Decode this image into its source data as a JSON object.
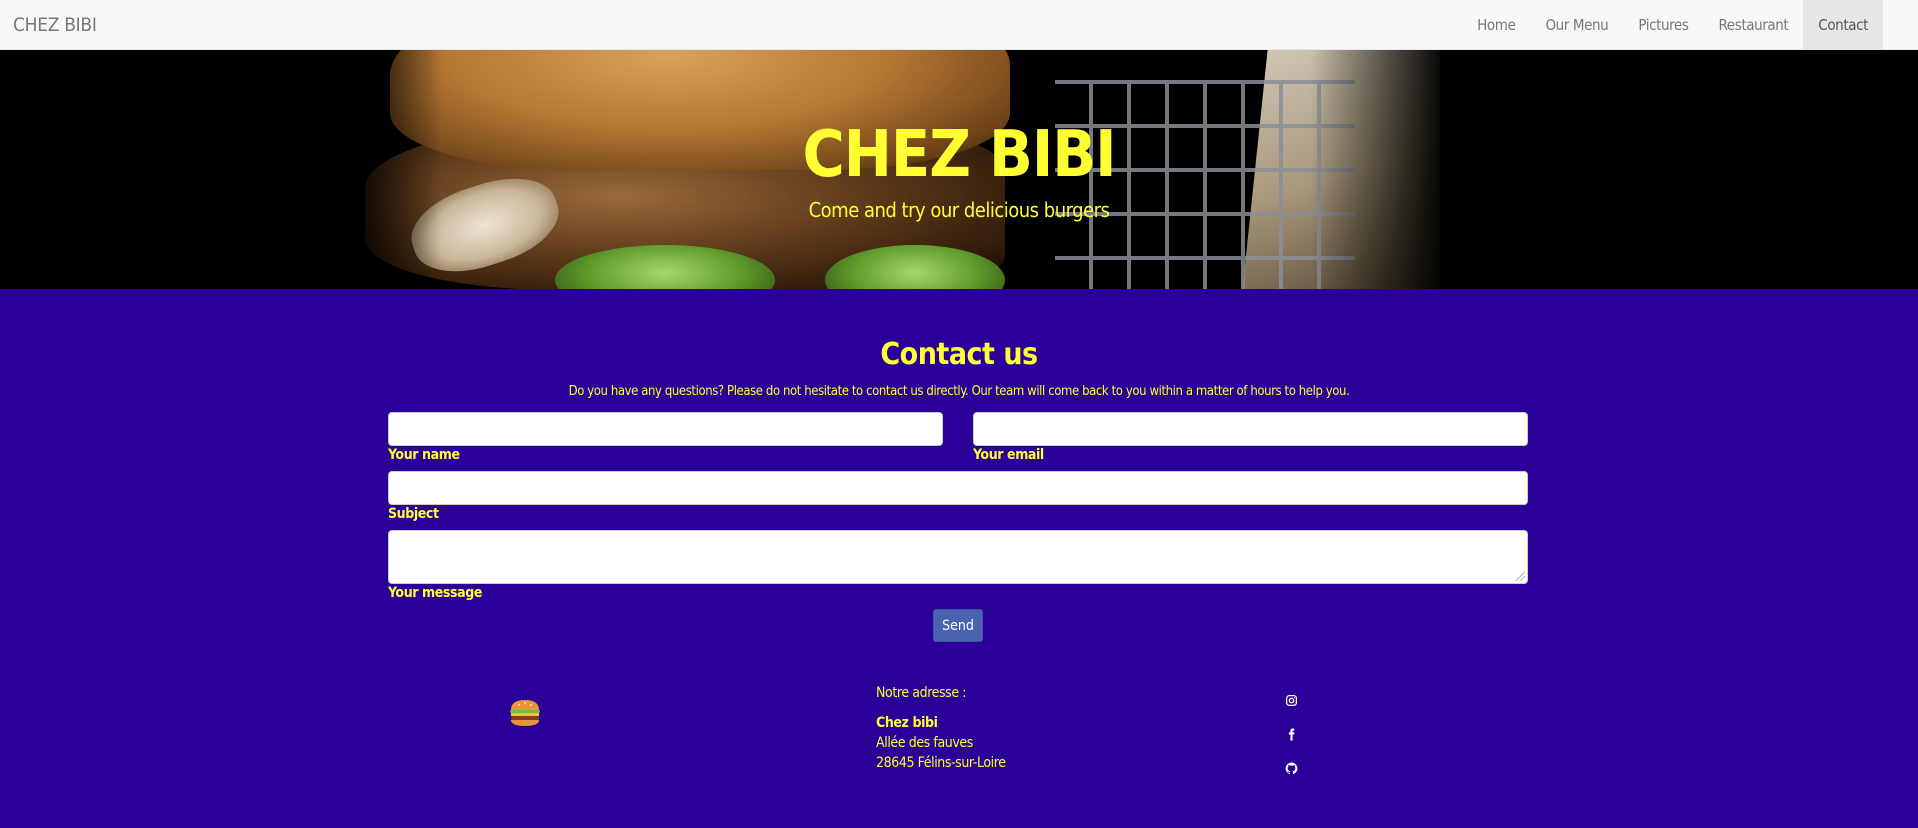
{
  "navbar": {
    "brand": "CHEZ BIBI",
    "links": [
      {
        "label": "Home"
      },
      {
        "label": "Our Menu"
      },
      {
        "label": "Pictures"
      },
      {
        "label": "Restaurant"
      },
      {
        "label": "Contact",
        "active": true
      }
    ]
  },
  "hero": {
    "title": "CHEZ BIBI",
    "subtitle": "Come and try our delicious burgers"
  },
  "contact": {
    "title": "Contact us",
    "description": "Do you have any questions? Please do not hesitate to contact us directly. Our team will come back to you within a matter of hours to help you.",
    "fields": {
      "name": {
        "label": "Your name",
        "value": ""
      },
      "email": {
        "label": "Your email",
        "value": ""
      },
      "subject": {
        "label": "Subject",
        "value": ""
      },
      "message": {
        "label": "Your message",
        "value": ""
      }
    },
    "send_label": "Send"
  },
  "footer": {
    "logo_icon": "burger-icon",
    "address_heading": "Notre adresse :",
    "address_name": "Chez bibi",
    "address_line1": "Allée des fauves",
    "address_line2": "28645 Félins-sur-Loire",
    "social_icons": [
      "instagram-icon",
      "facebook-icon",
      "github-icon"
    ]
  },
  "colors": {
    "page_background": "#2a0098",
    "accent_text": "#ffff33",
    "navbar_background": "#f8f8f8",
    "button_background": "#4a63b0"
  }
}
